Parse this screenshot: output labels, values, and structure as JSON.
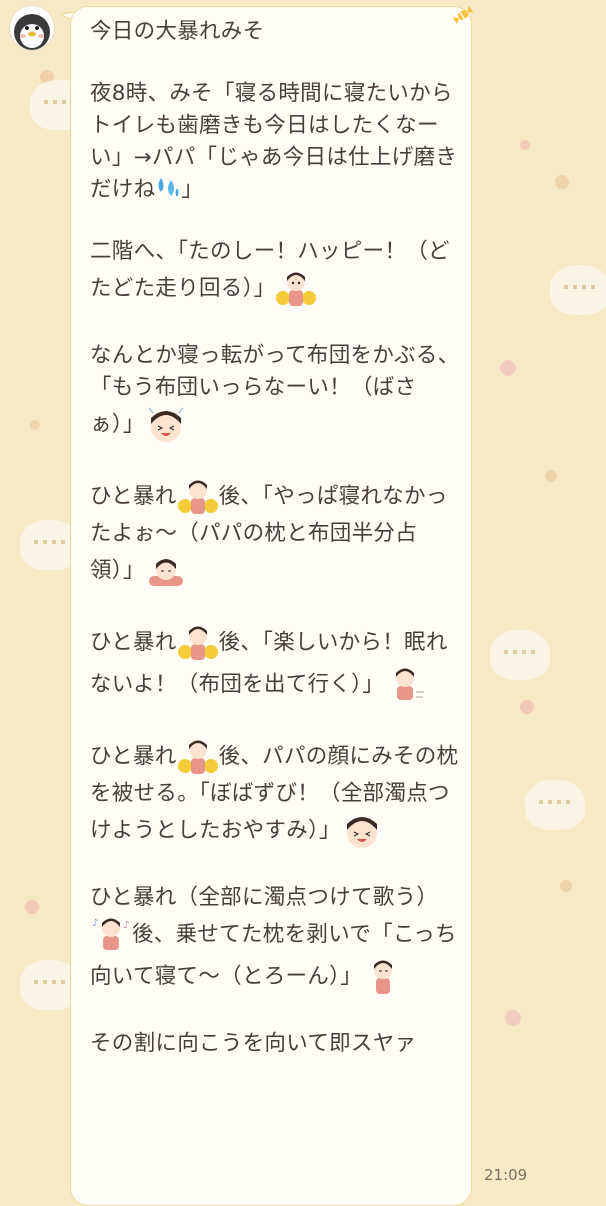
{
  "chat": {
    "timestamp": "21:09",
    "sender_icon": "penguin-avatar-icon",
    "message": {
      "title": "今日の大暴れみそ",
      "p1": "夜8時、みそ「寝る時間に寝たいからトイレも歯磨きも今日はしたくなーい」→パパ「じゃあ今日は仕上げ磨きだけね",
      "p1_end": "」",
      "p2": "二階へ、「たのしー！ハッピー！（どたどた走り回る）」",
      "p3": "なんとか寝っ転がって布団をかぶる、「もう布団いっらなーい！（ばさぁ）」",
      "p4a": "ひと暴れ",
      "p4b": "後、「やっぱ寝れなかったよぉ〜（パパの枕と布団半分占領）」",
      "p5a": "ひと暴れ",
      "p5b": "後、「楽しいから！眠れないよ！（布団を出て行く）」",
      "p6a": "ひと暴れ",
      "p6b": "後、パパの顔にみその枕を被せる。「ぼばずび！（全部濁点つけようとしたおやすみ）」",
      "p7a": "ひと暴れ（全部に濁点つけて歌う）",
      "p7b": "後、乗せてた枕を剥いで「こっち向いて寝て〜（とろーん）」",
      "p8": "その割に向こうを向いて即スヤァ"
    }
  },
  "colors": {
    "background": "#f7e9c6",
    "bubble": "#fffdf6",
    "bubble_border": "#efd99a",
    "text": "#4a3f36"
  }
}
